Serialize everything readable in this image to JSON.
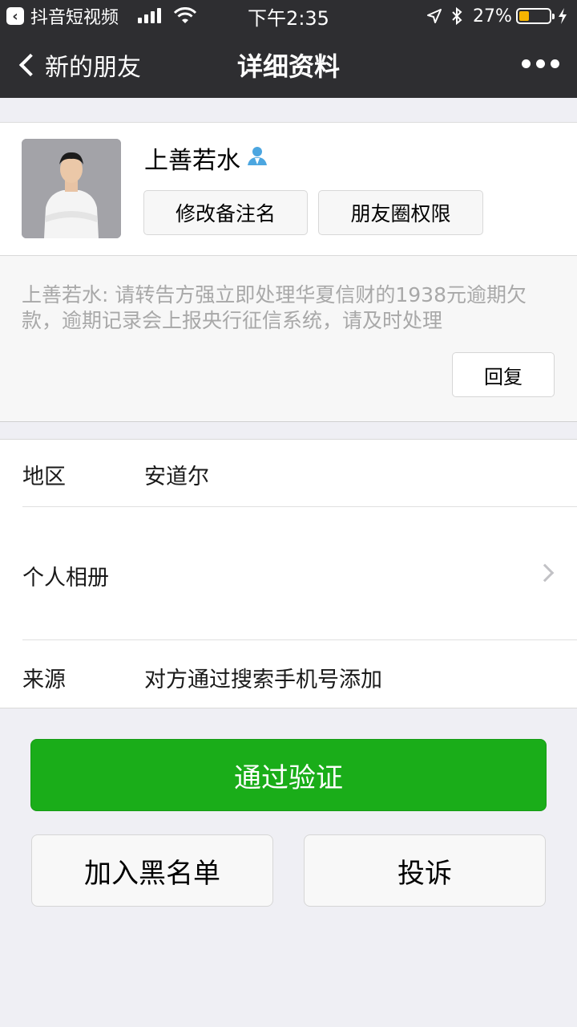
{
  "status_bar": {
    "back_app": "抖音短视频",
    "time": "下午2:35",
    "battery": "27%"
  },
  "nav": {
    "back_label": "新的朋友",
    "title": "详细资料"
  },
  "profile": {
    "name": "上善若水",
    "remark_button": "修改备注名",
    "moments_permission_button": "朋友圈权限"
  },
  "message": {
    "text": "上善若水: 请转告方强立即处理华夏信财的1938元逾期欠款，逾期记录会上报央行征信系统，请及时处理",
    "reply_button": "回复"
  },
  "info": {
    "region_label": "地区",
    "region_value": "安道尔",
    "album_label": "个人相册",
    "source_label": "来源",
    "source_value": "对方通过搜索手机号添加"
  },
  "actions": {
    "verify": "通过验证",
    "blacklist": "加入黑名单",
    "report": "投诉"
  },
  "colors": {
    "nav_bg": "#2e2e31",
    "primary_green": "#1aad19",
    "contact_icon_blue": "#4ca6e0",
    "battery_yellow": "#f7b500"
  }
}
